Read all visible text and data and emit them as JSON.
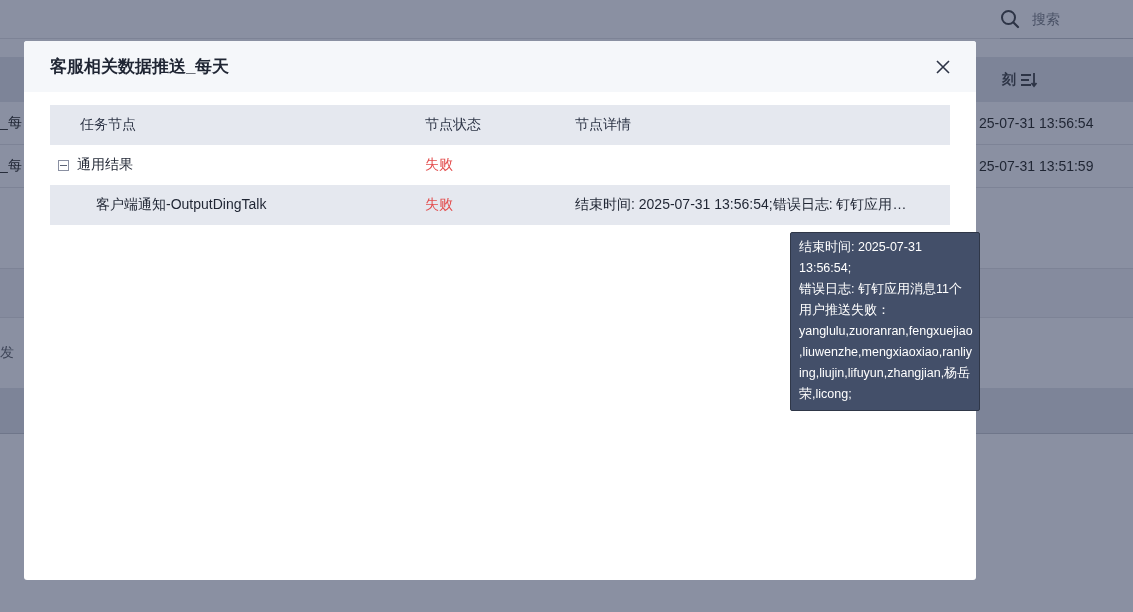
{
  "background_page": {
    "search": {
      "placeholder": "搜索"
    },
    "table": {
      "column_heading": "刻",
      "rows": [
        {
          "column_1": "_每",
          "time": "25-07-31 13:56:54"
        },
        {
          "column_1": "_每",
          "time": "25-07-31 13:51:59"
        }
      ]
    },
    "lower_row_text": "发"
  },
  "dialog": {
    "title": "客服相关数据推送_每天",
    "columns": [
      "任务节点",
      "节点状态",
      "节点详情"
    ],
    "nodes": [
      {
        "name": "通用结果",
        "status": "失败",
        "expanded": true,
        "highlighted": false,
        "children": [
          {
            "name": "客户端通知-OutputDingTalk",
            "status": "失败",
            "detail": "结束时间: 2025-07-31 13:56:54;错误日志: 钉钉应用…",
            "highlighted": true
          }
        ]
      }
    ]
  },
  "tooltip": {
    "lines": [
      "结束时间: 2025-07-31 13:56:54;",
      "错误日志: 钉钉应用消息11个用户推送失败：yanglulu,zuoranran,fengxuejiao,liuwenzhe,mengxiaoxiao,ranliying,liujin,lifuyun,zhangjian,杨岳荣,licong;"
    ]
  }
}
